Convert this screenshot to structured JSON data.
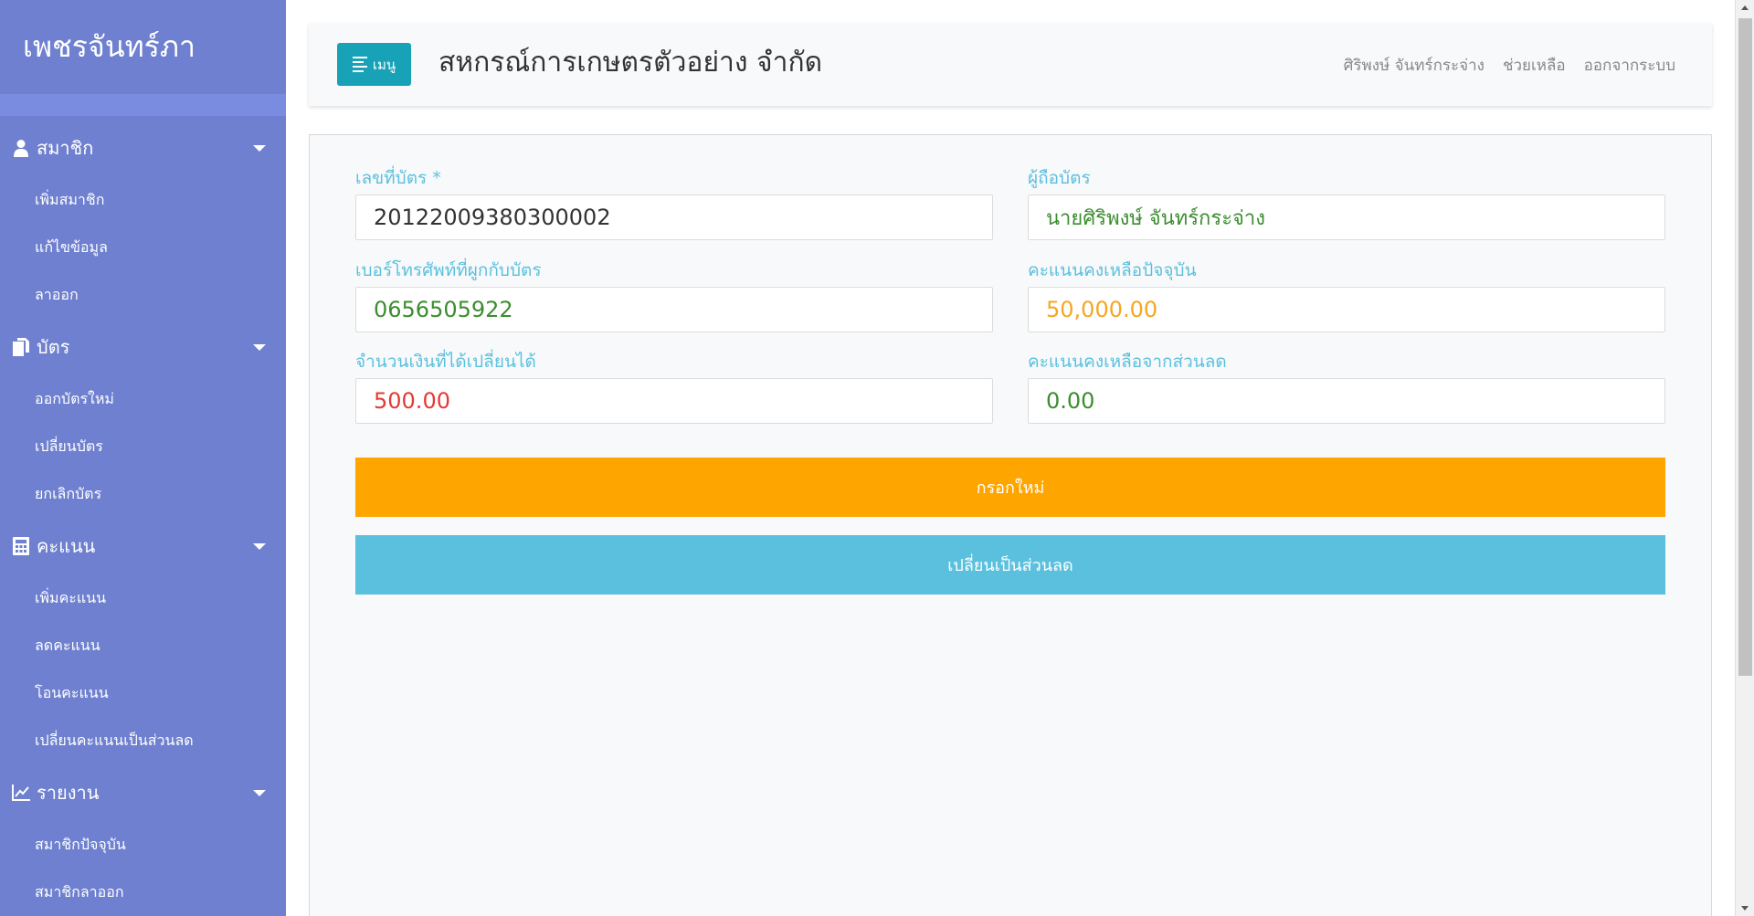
{
  "sidebar": {
    "brand": "เพชรจันทร์ภา",
    "groups": [
      {
        "icon": "user-icon",
        "label": "สมาชิก",
        "items": [
          "เพิ่มสมาชิก",
          "แก้ไขข้อมูล",
          "ลาออก"
        ]
      },
      {
        "icon": "copy-icon",
        "label": "บัตร",
        "items": [
          "ออกบัตรใหม่",
          "เปลี่ยนบัตร",
          "ยกเลิกบัตร"
        ]
      },
      {
        "icon": "calculator-icon",
        "label": "คะแนน",
        "items": [
          "เพิ่มคะแนน",
          "ลดคะแนน",
          "โอนคะแนน",
          "เปลี่ยนคะแนนเป็นส่วนลด"
        ]
      },
      {
        "icon": "chart-line-icon",
        "label": "รายงาน",
        "items": [
          "สมาชิกปัจจุบัน",
          "สมาชิกลาออก"
        ]
      }
    ]
  },
  "header": {
    "menu_label": "เมนู",
    "title": "สหกรณ์การเกษตรตัวอย่าง จำกัด",
    "links": [
      "ศิริพงษ์ จันทร์กระจ่าง",
      "ช่วยเหลือ",
      "ออกจากระบบ"
    ]
  },
  "form": {
    "card_no": {
      "label": "เลขที่บัตร *",
      "value": "20122009380300002"
    },
    "holder": {
      "label": "ผู้ถือบัตร",
      "value": "นายศิริพงษ์ จันทร์กระจ่าง"
    },
    "phone": {
      "label": "เบอร์โทรศัพท์ที่ผูกกับบัตร",
      "value": "0656505922"
    },
    "balance": {
      "label": "คะแนนคงเหลือปัจจุบัน",
      "value": "50,000.00"
    },
    "exchangeable": {
      "label": "จำนวนเงินที่ได้เปลี่ยนได้",
      "value": "500.00"
    },
    "discount_balance": {
      "label": "คะแนนคงเหลือจากส่วนลด",
      "value": "0.00"
    },
    "reset_button": "กรอกใหม่",
    "convert_button": "เปลี่ยนเป็นส่วนลด"
  },
  "colors": {
    "sidebar": "#6e80cf",
    "accent": "#17a2b8",
    "label": "#5bc0de",
    "green_value": "#3c8d2f",
    "orange_value": "#f5a623",
    "red_value": "#e53935",
    "reset_button": "#ffa500",
    "convert_button": "#5bc0de"
  }
}
